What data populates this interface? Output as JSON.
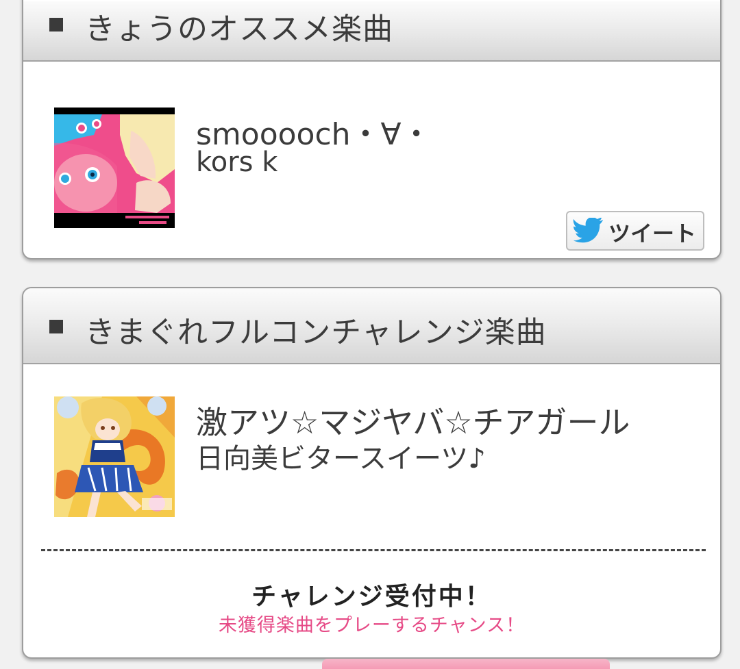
{
  "recommend": {
    "header_title": "きょうのオススメ楽曲",
    "song_title": "smooooch・∀・",
    "song_artist": "kors k",
    "jacket_caption": "smooooch・∀・ kors k",
    "tweet_label": "ツイート"
  },
  "challenge": {
    "header_title": "きまぐれフルコンチャレンジ楽曲",
    "song_title": "激アツ☆マジヤバ☆チアガール",
    "song_artist": "日向美ビタースイーツ♪",
    "status": "チャレンジ受付中！",
    "note": "未獲得楽曲をプレーするチャンス！"
  },
  "colors": {
    "page_bg": "#f1f1f1",
    "accent_pink": "#e64a86",
    "twitter_blue": "#2aa3e6",
    "header_text": "#3b3b3b"
  },
  "icons": {
    "header_bullet": "square-bullet-icon",
    "tweet": "twitter-bird-icon"
  }
}
